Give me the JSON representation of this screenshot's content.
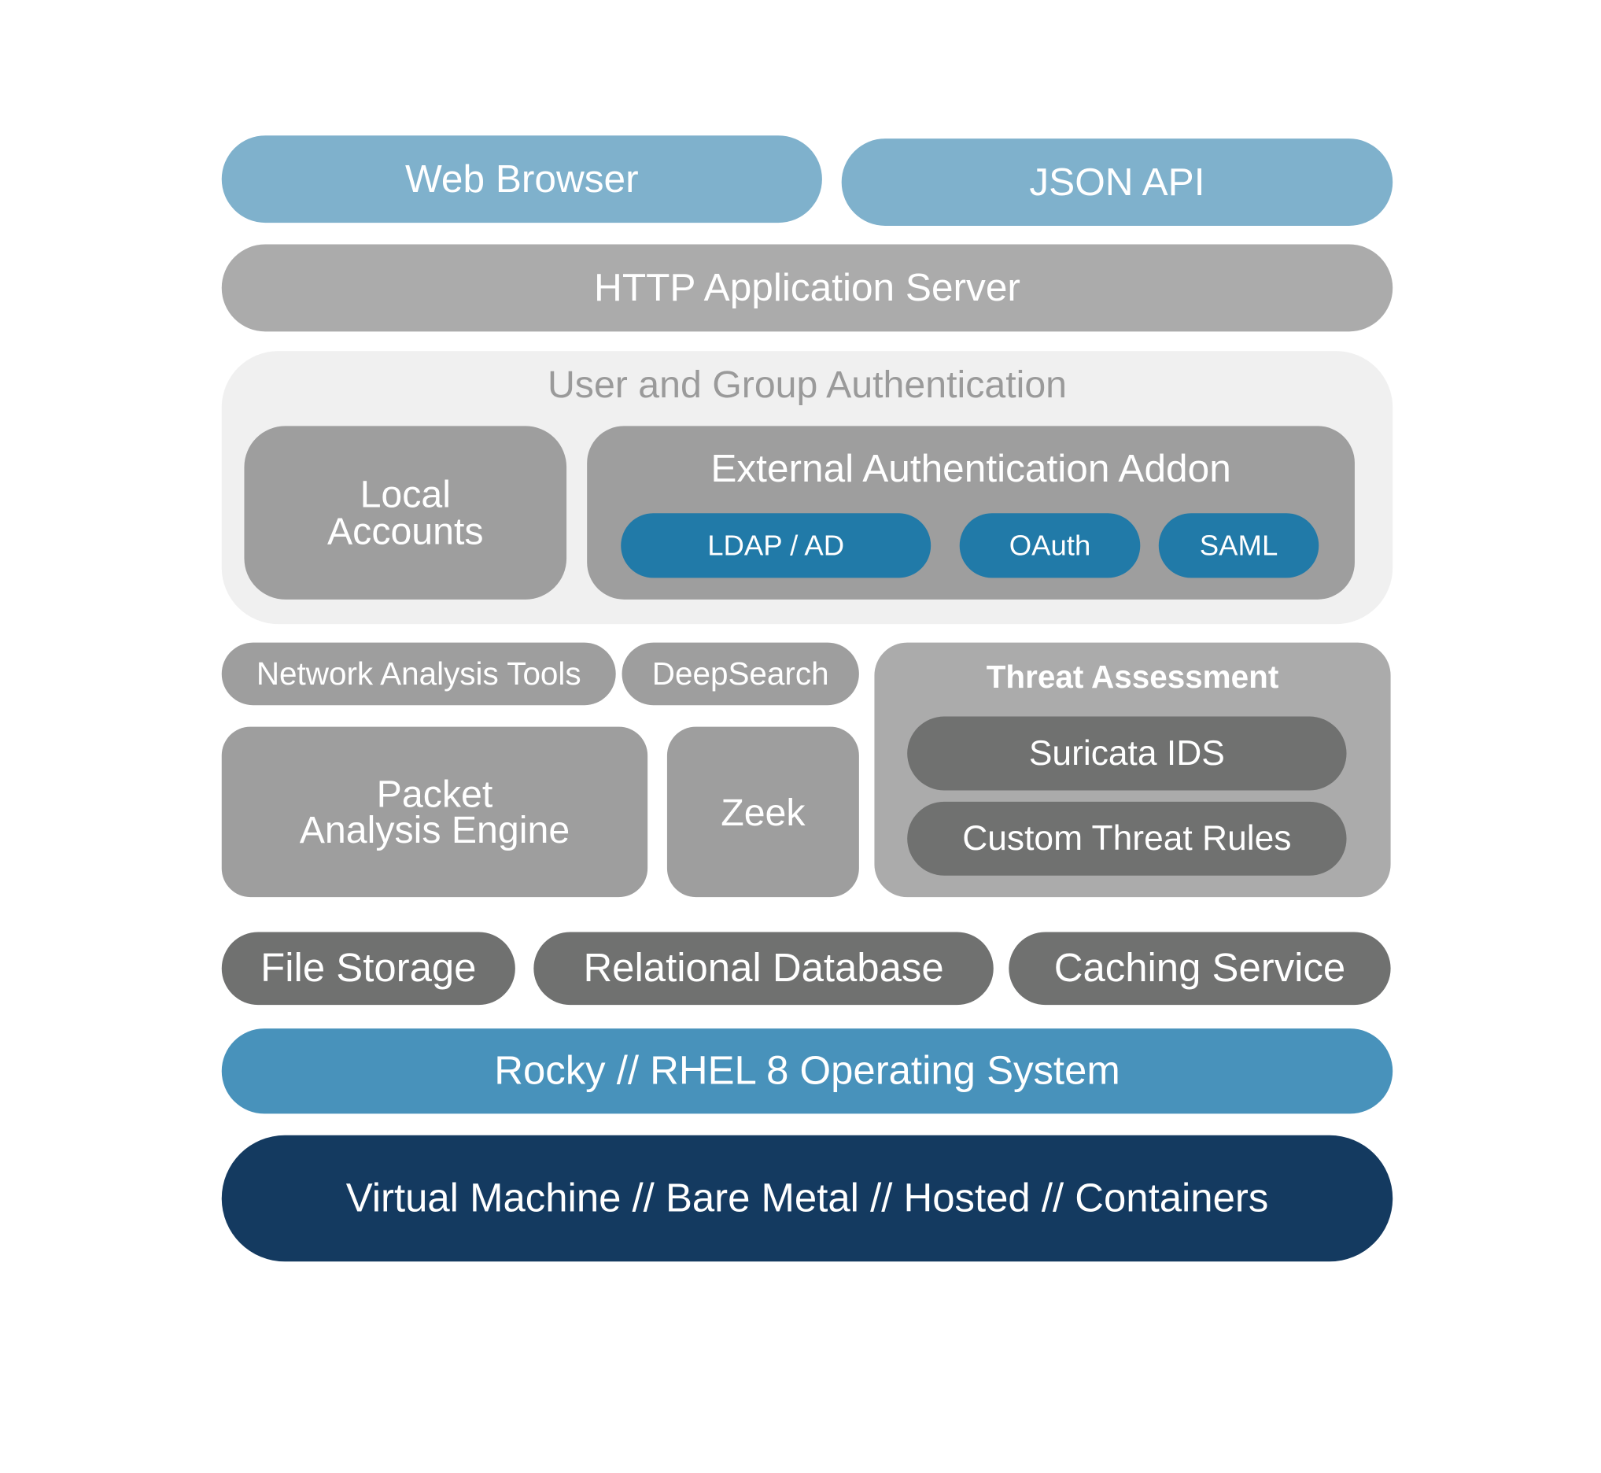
{
  "client_layer": {
    "web_browser": "Web Browser",
    "json_api": "JSON API"
  },
  "server_layer": {
    "http_server": "HTTP Application Server"
  },
  "auth": {
    "title": "User and Group Authentication",
    "local_accounts_line1": "Local",
    "local_accounts_line2": "Accounts",
    "external": {
      "title": "External Authentication Addon",
      "providers": [
        "LDAP / AD",
        "OAuth",
        "SAML"
      ]
    }
  },
  "analysis": {
    "network_tools": "Network Analysis Tools",
    "deepsearch": "DeepSearch",
    "packet_line1": "Packet",
    "packet_line2": "Analysis Engine",
    "zeek": "Zeek",
    "threat": {
      "title": "Threat Assessment",
      "items": [
        "Suricata IDS",
        "Custom Threat Rules"
      ]
    }
  },
  "storage": [
    "File Storage",
    "Relational Database",
    "Caching Service"
  ],
  "os": "Rocky // RHEL 8 Operating System",
  "platform": "Virtual Machine // Bare Metal // Hosted // Containers",
  "colors": {
    "light_blue": "#7fb1cc",
    "gray": "#ababab",
    "mid_gray": "#9e9e9e",
    "dark_gray": "#707170",
    "auth_bg": "#f0f0f0",
    "provider_blue": "#217aa8",
    "os_blue": "#4892bb",
    "navy": "#143a60"
  }
}
